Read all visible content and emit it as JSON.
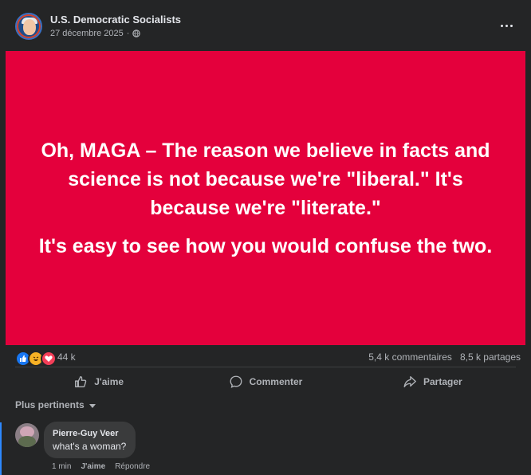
{
  "post": {
    "page_name": "U.S. Democratic Socialists",
    "date": "27 décembre 2025",
    "separator": "·",
    "privacy_icon": "globe-icon",
    "more_icon": "more-options-icon",
    "image_text_1": "Oh, MAGA – The reason we believe in facts and science is not because we're \"liberal.\" It's because we're \"literate.\"",
    "image_text_2": "It's easy to see how you would confuse the two.",
    "image_bg_color": "#e4003c"
  },
  "stats": {
    "reaction_icons": [
      "like-icon",
      "haha-icon",
      "love-icon"
    ],
    "reaction_count": "44 k",
    "comments": "5,4 k commentaires",
    "shares": "8,5 k partages"
  },
  "actions": {
    "like_label": "J'aime",
    "comment_label": "Commenter",
    "share_label": "Partager"
  },
  "comments_section": {
    "filter_label": "Plus pertinents",
    "comments": [
      {
        "author": "Pierre-Guy Veer",
        "text": "what's a woman?",
        "time": "1 min",
        "like_label": "J'aime",
        "reply_label": "Répondre"
      }
    ]
  }
}
